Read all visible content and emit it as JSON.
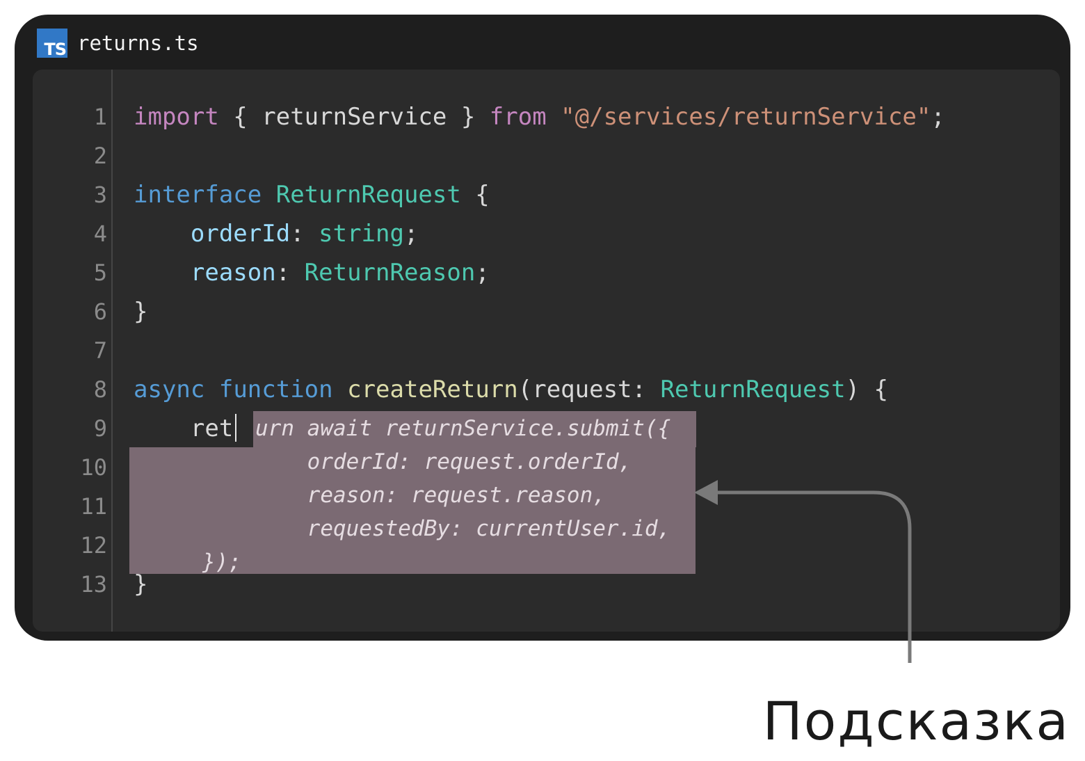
{
  "tab": {
    "icon": "typescript-file-icon",
    "icon_label": "TS",
    "filename": "returns.ts"
  },
  "colors": {
    "window_bg": "#1e1e1e",
    "editor_bg": "#2b2b2b",
    "suggestion_bg": "#7b6a73",
    "ts_blue": "#3178c6"
  },
  "editor": {
    "line_numbers": [
      "1",
      "2",
      "3",
      "4",
      "5",
      "6",
      "7",
      "8",
      "9",
      "10",
      "11",
      "12",
      "13"
    ],
    "line1": {
      "kw_import": "import",
      "open": " { ",
      "ident": "returnService",
      "close": " } ",
      "kw_from": "from",
      "space": " ",
      "string": "\"@/services/returnService\"",
      "semi": ";"
    },
    "line3": {
      "kw": "interface",
      "space": " ",
      "name": "ReturnRequest",
      "brace": " {"
    },
    "line4": {
      "indent": "    ",
      "prop": "orderId",
      "colon": ": ",
      "type": "string",
      "semi": ";"
    },
    "line5": {
      "indent": "    ",
      "prop": "reason",
      "colon": ": ",
      "type": "ReturnReason",
      "semi": ";"
    },
    "line6": "}",
    "line8": {
      "kw_async": "async",
      "sp1": " ",
      "kw_function": "function",
      "sp2": " ",
      "fn": "createReturn",
      "paren": "(",
      "param": "request",
      "colon": ": ",
      "type": "ReturnRequest",
      "close": ") {"
    },
    "line9_typed": "    ret",
    "line13": "}"
  },
  "suggestion": {
    "lines": [
      "urn await returnService.submit({",
      "    orderId: request.orderId,",
      "    reason: request.reason,",
      "    requestedBy: currentUser.id,",
      "});"
    ]
  },
  "annotation": {
    "label": "Подсказка"
  }
}
